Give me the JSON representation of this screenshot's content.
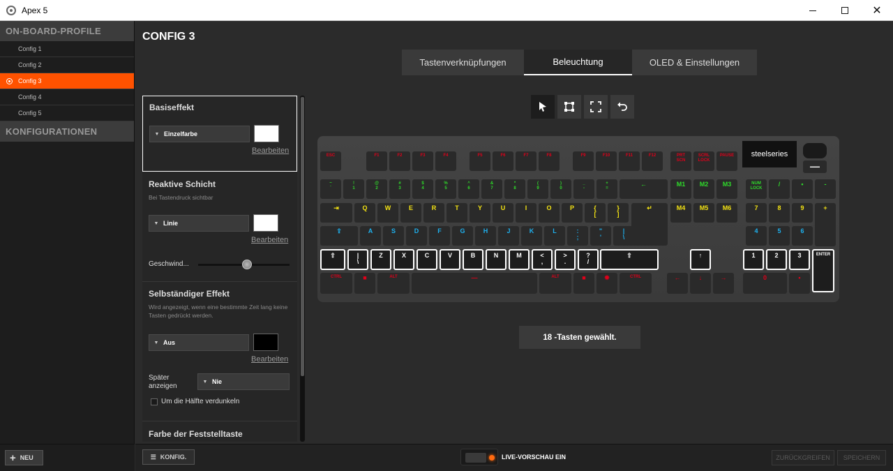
{
  "window": {
    "title": "Apex 5"
  },
  "sidebar": {
    "onboard_header": "ON-BOARD-PROFILE",
    "profiles": [
      {
        "label": "Config 1",
        "active": false
      },
      {
        "label": "Config 2",
        "active": false
      },
      {
        "label": "Config 3",
        "active": true
      },
      {
        "label": "Config 4",
        "active": false
      },
      {
        "label": "Config 5",
        "active": false
      }
    ],
    "configs_header": "KONFIGURATIONEN",
    "new_label": "NEU"
  },
  "main": {
    "title": "CONFIG 3",
    "tabs": [
      {
        "label": "Tastenverknüpfungen"
      },
      {
        "label": "Beleuchtung",
        "active": true
      },
      {
        "label": "OLED & Einstellungen"
      }
    ]
  },
  "panel": {
    "base": {
      "title": "Basiseffekt",
      "select": "Einzelfarbe",
      "swatch": "#ffffff",
      "edit": "Bearbeiten"
    },
    "reactive": {
      "title": "Reaktive Schicht",
      "subtitle": "Bei Tastendruck sichtbar",
      "select": "Linie",
      "swatch": "#ffffff",
      "edit": "Bearbeiten",
      "speed_label": "Geschwind...",
      "speed_value": 0.52
    },
    "standalone": {
      "title": "Selbständiger Effekt",
      "subtitle": "Wird angezeigt, wenn eine bestimmte Zeit lang keine Tasten gedrückt werden.",
      "select": "Aus",
      "swatch": "#000000",
      "edit": "Bearbeiten",
      "later_label": "Später anzeigen",
      "later_select": "Nie",
      "dim_label": "Um die Hälfte verdunkeln",
      "dim_checked": false
    },
    "capslock": {
      "title": "Farbe der Feststelltaste"
    }
  },
  "tools": [
    "cursor-select",
    "rect-select",
    "fullscreen",
    "undo"
  ],
  "keyboard": {
    "logo": "steelseries",
    "colors": {
      "red": "#e0001a",
      "green": "#2fdc2a",
      "yellow": "#f4e313",
      "blue": "#1eb1ef",
      "selected_border": "#ffffff"
    }
  },
  "status": {
    "text": "18 -Tasten gewählt."
  },
  "footer": {
    "config_label": "KONFIG.",
    "preview_label": "LIVE-VORSCHAU EIN",
    "revert_label": "ZURÜCKGREIFEN",
    "save_label": "SPEICHERN"
  }
}
